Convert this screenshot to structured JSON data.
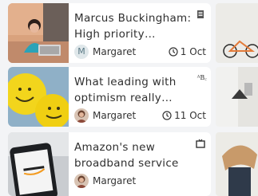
{
  "cards": [
    {
      "title": "Marcus Buckingham: High priority interrupt...",
      "author": "Margaret",
      "avatar_initial": "M",
      "date": "1 Oct",
      "type_icon": "document-icon"
    },
    {
      "title": "What leading with optimism really looks...",
      "author": "Margaret",
      "date": "11 Oct",
      "type_icon": "text-style-icon",
      "type_glyph": "ᴬB꜀"
    },
    {
      "title": "Amazon's new broadband service",
      "author": "Margaret",
      "type_icon": "tv-icon"
    }
  ],
  "colors": {
    "background": "#f3f4f6",
    "card": "#ffffff",
    "text": "#2f2f2f"
  }
}
